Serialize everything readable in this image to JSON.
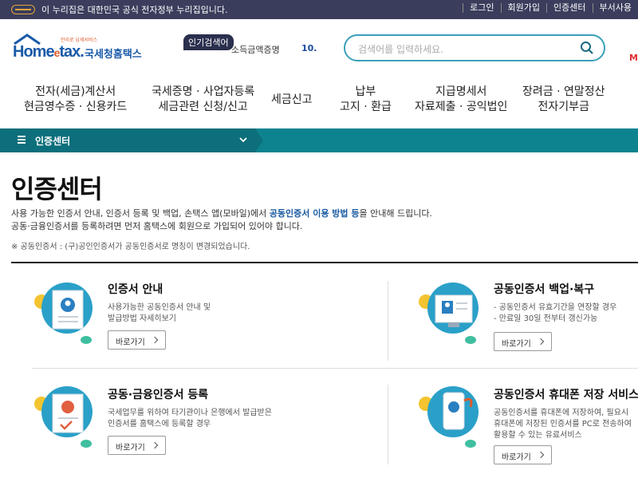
{
  "topbar": {
    "gov_text": "이 누리집은 대한민국 공식 전자정부 누리집입니다.",
    "links": [
      "로그인",
      "회원가입",
      "인증센터",
      "부서사용"
    ]
  },
  "header": {
    "logo_text": "Home",
    "logo_e": "e",
    "logo_tax": "tax.",
    "logo_korean": "국세청홈택스",
    "logo_tagline": "안리로 납세서비스",
    "popular_label": "인기검색어",
    "popular_keyword": "소득금액증명",
    "popular_rank": "10. ",
    "search_placeholder": "검색어를 입력하세요.",
    "right_letter": "M"
  },
  "gnb": {
    "items": [
      [
        "전자(세금)계산서",
        "현금영수증 · 신용카드"
      ],
      [
        "국세증명 · 사업자등록",
        "세금관련 신청/신고"
      ],
      [
        "세금신고"
      ],
      [
        "납부",
        "고지 · 환급"
      ],
      [
        "지급명세서",
        "자료제출 · 공익법인"
      ],
      [
        "장려금 · 연말정산",
        "전자기부금"
      ]
    ]
  },
  "breadcrumb": {
    "label": "인증센터"
  },
  "page": {
    "title": "인증센터",
    "desc_1a": "사용 가능한 인증서 안내, 인증서 등록 및 백업, 손택스 앱(모바일)에서 ",
    "desc_1b": "공동인증서 이용 방법 등",
    "desc_1c": "을 안내해 드립니다.",
    "desc_2": "공동·금융인증서를 등록하려면 먼저 홈택스에 회원으로 가입되어 있어야 합니다.",
    "note": "※ 공동인증서 : (구)공인인증서가 공동인증서로 명칭이 변경되었습니다."
  },
  "cards": [
    {
      "title": "인증서 안내",
      "lines": [
        "사용가능한 공동인증서 안내 및",
        "발급방법 자세히보기"
      ],
      "button": "바로가기"
    },
    {
      "title": "공동인증서 백업·복구",
      "lines": [
        "- 공동인증서 유효기간을 연장할 경우",
        "- 만료일 30일 전부터 갱신가능"
      ],
      "button": "바로가기"
    },
    {
      "title": "공동·금융인증서 등록",
      "lines": [
        "국세업무를 위하여 타기관이나 은행에서 발급받은",
        "인증서를 홈택스에 등록할 경우"
      ],
      "button": "바로가기"
    },
    {
      "title": "공동인증서 휴대폰 저장 서비스",
      "lines": [
        "공동인증서를 휴대폰에 저장하여, 필요시",
        "휴대폰에 저장된 인증서를 PC로 전송하여",
        "활용할 수 있는 유료서비스"
      ],
      "button": "바로가기"
    }
  ],
  "colors": {
    "accent": "#0e8390",
    "topbar": "#3a3d5c",
    "brand": "#1a5aa8"
  }
}
